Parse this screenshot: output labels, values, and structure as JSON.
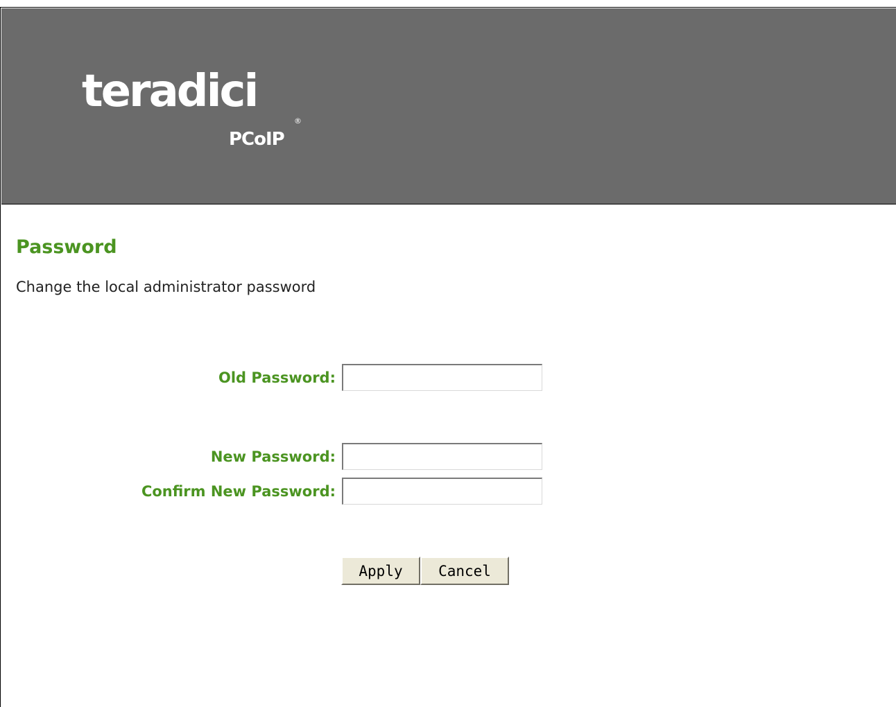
{
  "header": {
    "brand": "teradici",
    "brand_registered": "®",
    "product": "PCoIP",
    "background_color": "#6b6b6b"
  },
  "page": {
    "title": "Password",
    "description": "Change the local administrator password",
    "accent_color": "#4b9421"
  },
  "form": {
    "old_password_label": "Old Password:",
    "old_password_value": "",
    "new_password_label": "New Password:",
    "new_password_value": "",
    "confirm_password_label": "Confirm New Password:",
    "confirm_password_value": "",
    "apply_label": "Apply",
    "cancel_label": "Cancel"
  }
}
